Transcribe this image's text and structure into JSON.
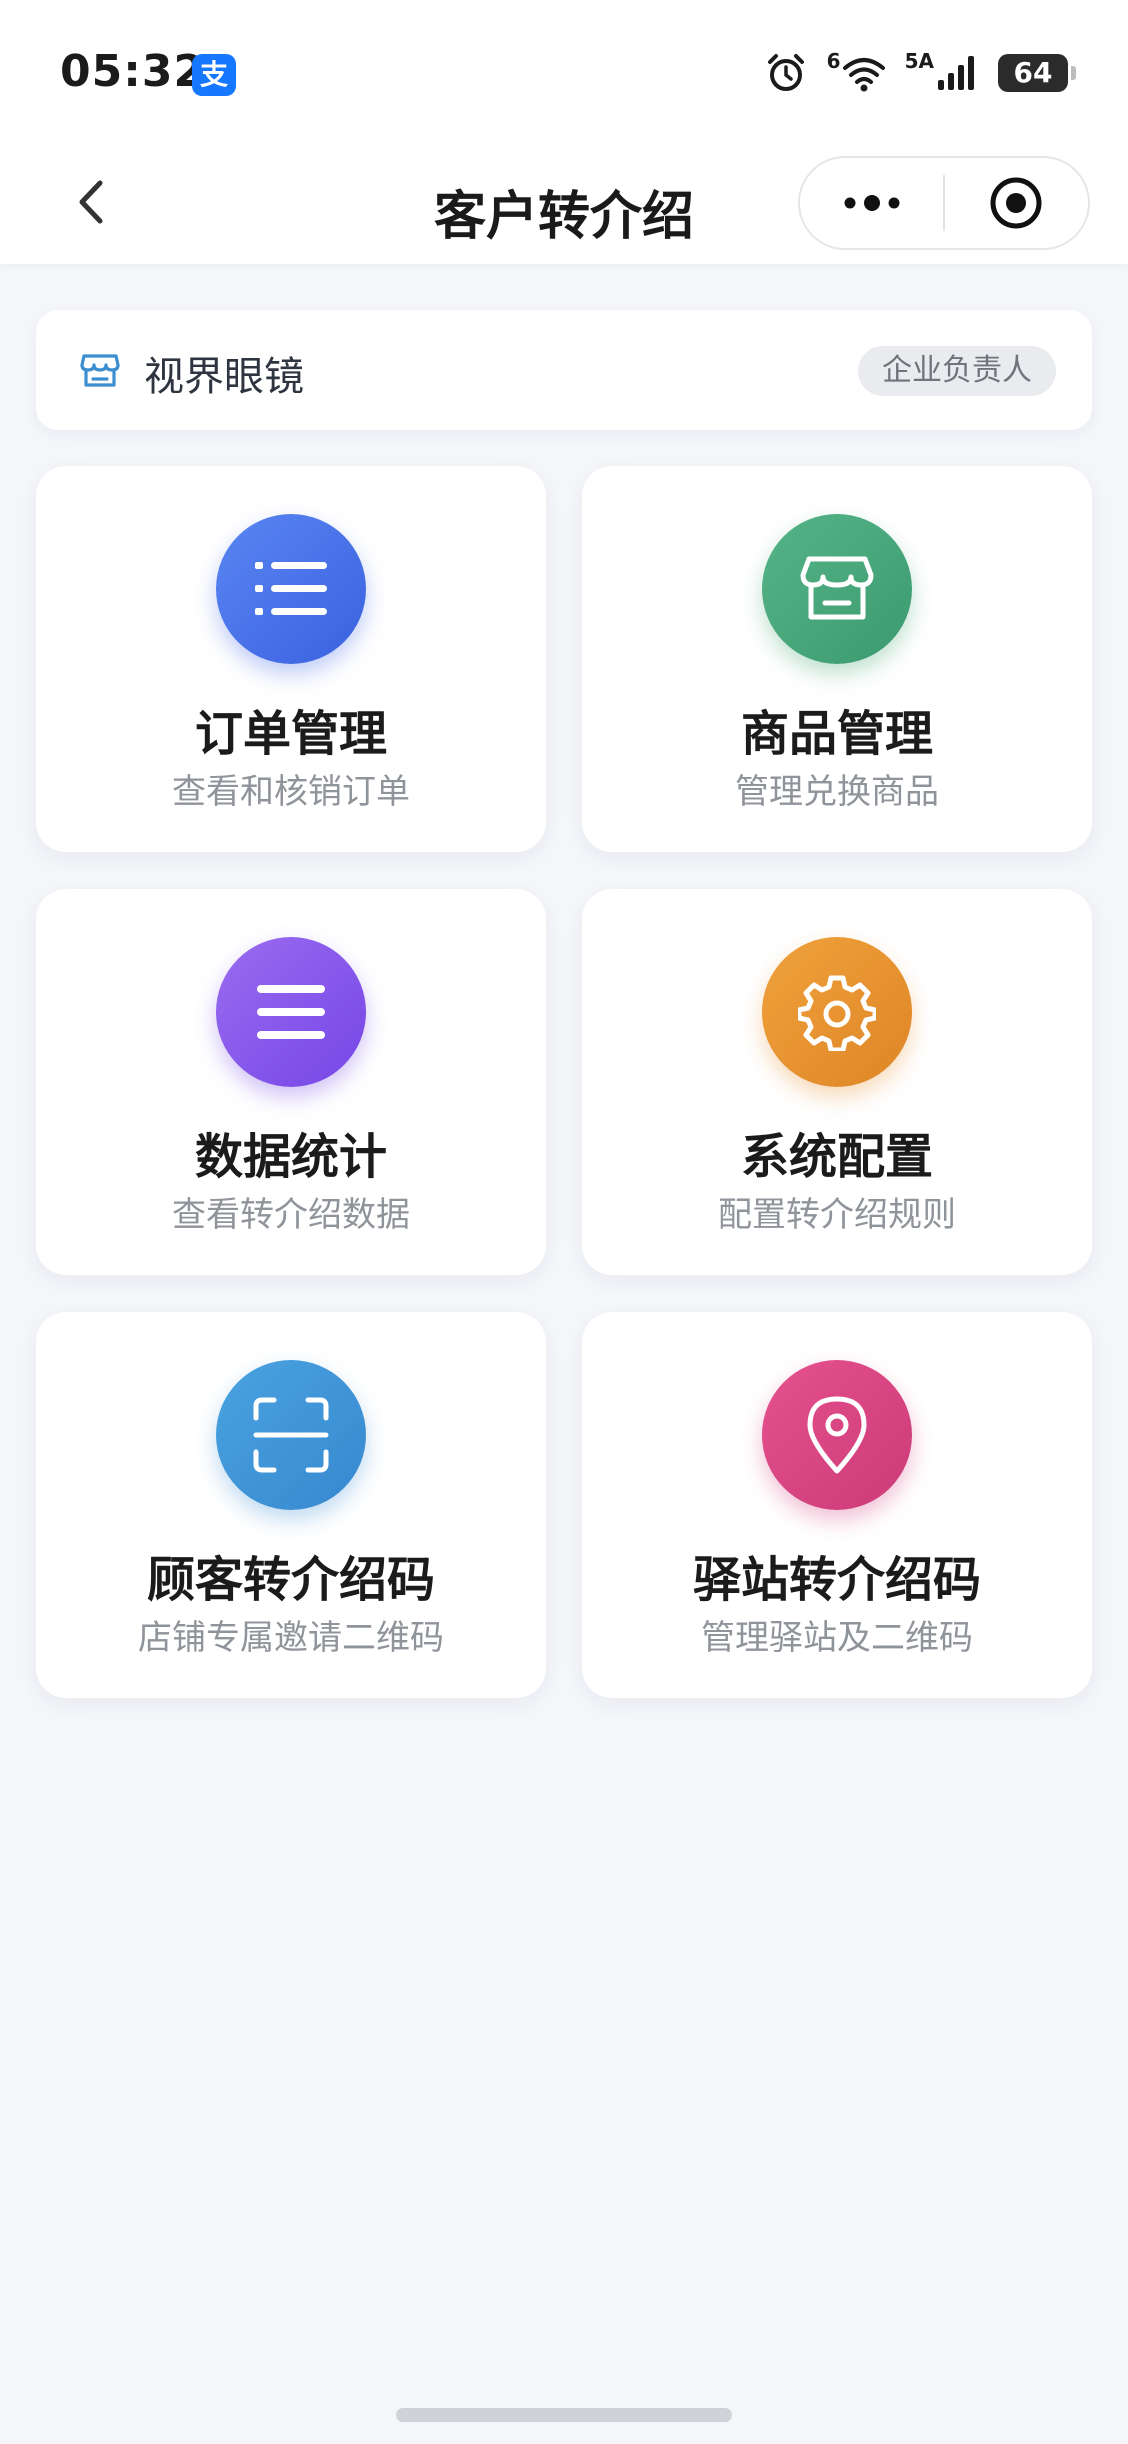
{
  "status_bar": {
    "time": "05:32",
    "alipay_glyph": "支",
    "wifi_label": "6",
    "cell_label": "5A",
    "battery": "64"
  },
  "nav": {
    "title": "客户转介绍"
  },
  "store": {
    "name": "视界眼镜",
    "role": "企业负责人"
  },
  "cards": [
    {
      "title": "订单管理",
      "subtitle": "查看和核销订单",
      "icon": "list-icon",
      "color": "#4a73e9"
    },
    {
      "title": "商品管理",
      "subtitle": "管理兑换商品",
      "icon": "store-icon",
      "color": "#48a77b"
    },
    {
      "title": "数据统计",
      "subtitle": "查看转介绍数据",
      "icon": "menu-icon",
      "color": "#8656ea"
    },
    {
      "title": "系统配置",
      "subtitle": "配置转介绍规则",
      "icon": "gear-icon",
      "color": "#e8942f"
    },
    {
      "title": "顾客转介绍码",
      "subtitle": "店铺专属邀请二维码",
      "icon": "scan-icon",
      "color": "#3f95d8"
    },
    {
      "title": "驿站转介绍码",
      "subtitle": "管理驿站及二维码",
      "icon": "location-pin-icon",
      "color": "#da4583"
    }
  ]
}
